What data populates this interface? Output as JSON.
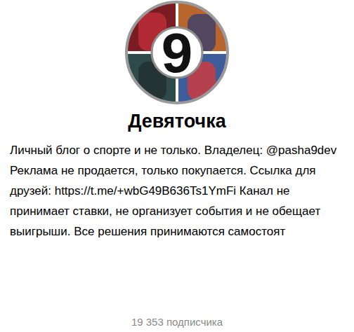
{
  "avatar": {
    "logo": "9"
  },
  "channel": {
    "title": "Девяточка",
    "description": "Личный блог о спорте и не только. Владелец: @pasha9dev Реклама не продается, только покупается. Ссылка для друзей: https://t.me/+wbG49B636Ts1YmFi Канал не принимает ставки, не организует события и не обещает выигрыши. Все решения принимаются самостоят",
    "subscribers": "19 353 подписчика"
  }
}
